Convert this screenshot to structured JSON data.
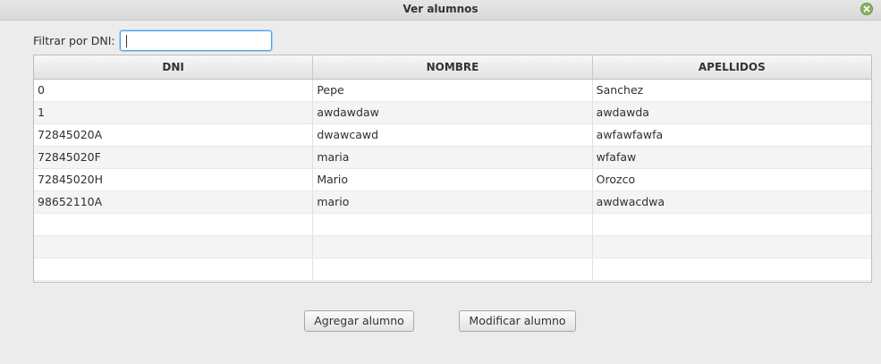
{
  "window": {
    "title": "Ver alumnos"
  },
  "filter": {
    "label": "Filtrar por DNI:",
    "value": ""
  },
  "table": {
    "columns": [
      "DNI",
      "NOMBRE",
      "APELLIDOS"
    ],
    "rows": [
      [
        "0",
        "Pepe",
        "Sanchez"
      ],
      [
        "1",
        "awdawdaw",
        "awdawda"
      ],
      [
        "72845020A",
        "dwawcawd",
        "awfawfawfa"
      ],
      [
        "72845020F",
        "maria",
        "wfafaw"
      ],
      [
        "72845020H",
        "Mario",
        "Orozco"
      ],
      [
        "98652110A",
        "mario",
        "awdwacdwa"
      ]
    ]
  },
  "buttons": {
    "add": "Agregar alumno",
    "modify": "Modificar alumno"
  },
  "colors": {
    "accent_focus": "#4c9ee0",
    "close": "#8ab35d"
  }
}
